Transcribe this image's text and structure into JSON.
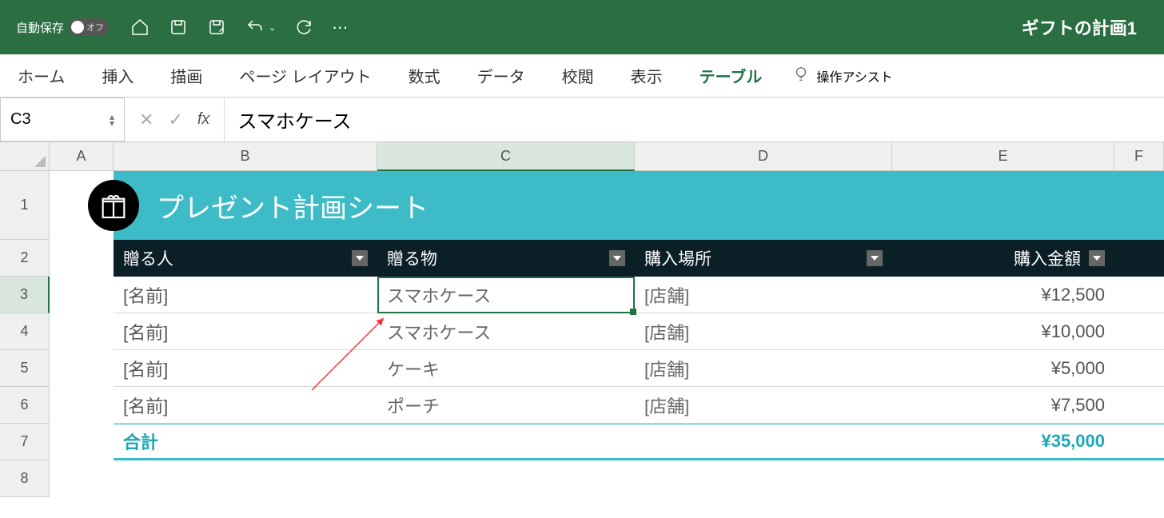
{
  "titlebar": {
    "autosave_label": "自動保存",
    "toggle_label": "オフ",
    "workbook_name": "ギフトの計画1"
  },
  "ribbon": {
    "tabs": [
      "ホーム",
      "挿入",
      "描画",
      "ページ レイアウト",
      "数式",
      "データ",
      "校閲",
      "表示",
      "テーブル"
    ],
    "active_index": 8,
    "assist_label": "操作アシスト"
  },
  "formula_bar": {
    "name_box": "C3",
    "fx_label": "fx",
    "formula_value": "スマホケース"
  },
  "columns": [
    "A",
    "B",
    "C",
    "D",
    "E",
    "F"
  ],
  "selected_column_index": 2,
  "row_labels": [
    "1",
    "2",
    "3",
    "4",
    "5",
    "6",
    "7",
    "8"
  ],
  "selected_row_index": 2,
  "sheet": {
    "title": "プレゼント計画シート",
    "headers": [
      "贈る人",
      "贈る物",
      "購入場所",
      "購入金額"
    ],
    "rows": [
      {
        "person": "[名前]",
        "item": "スマホケース",
        "place": "[店舗]",
        "amount": "¥12,500"
      },
      {
        "person": "[名前]",
        "item": "スマホケース",
        "place": "[店舗]",
        "amount": "¥10,000"
      },
      {
        "person": "[名前]",
        "item": "ケーキ",
        "place": "[店舗]",
        "amount": "¥5,000"
      },
      {
        "person": "[名前]",
        "item": "ポーチ",
        "place": "[店舗]",
        "amount": "¥7,500"
      }
    ],
    "total_label": "合計",
    "total_amount": "¥35,000"
  }
}
